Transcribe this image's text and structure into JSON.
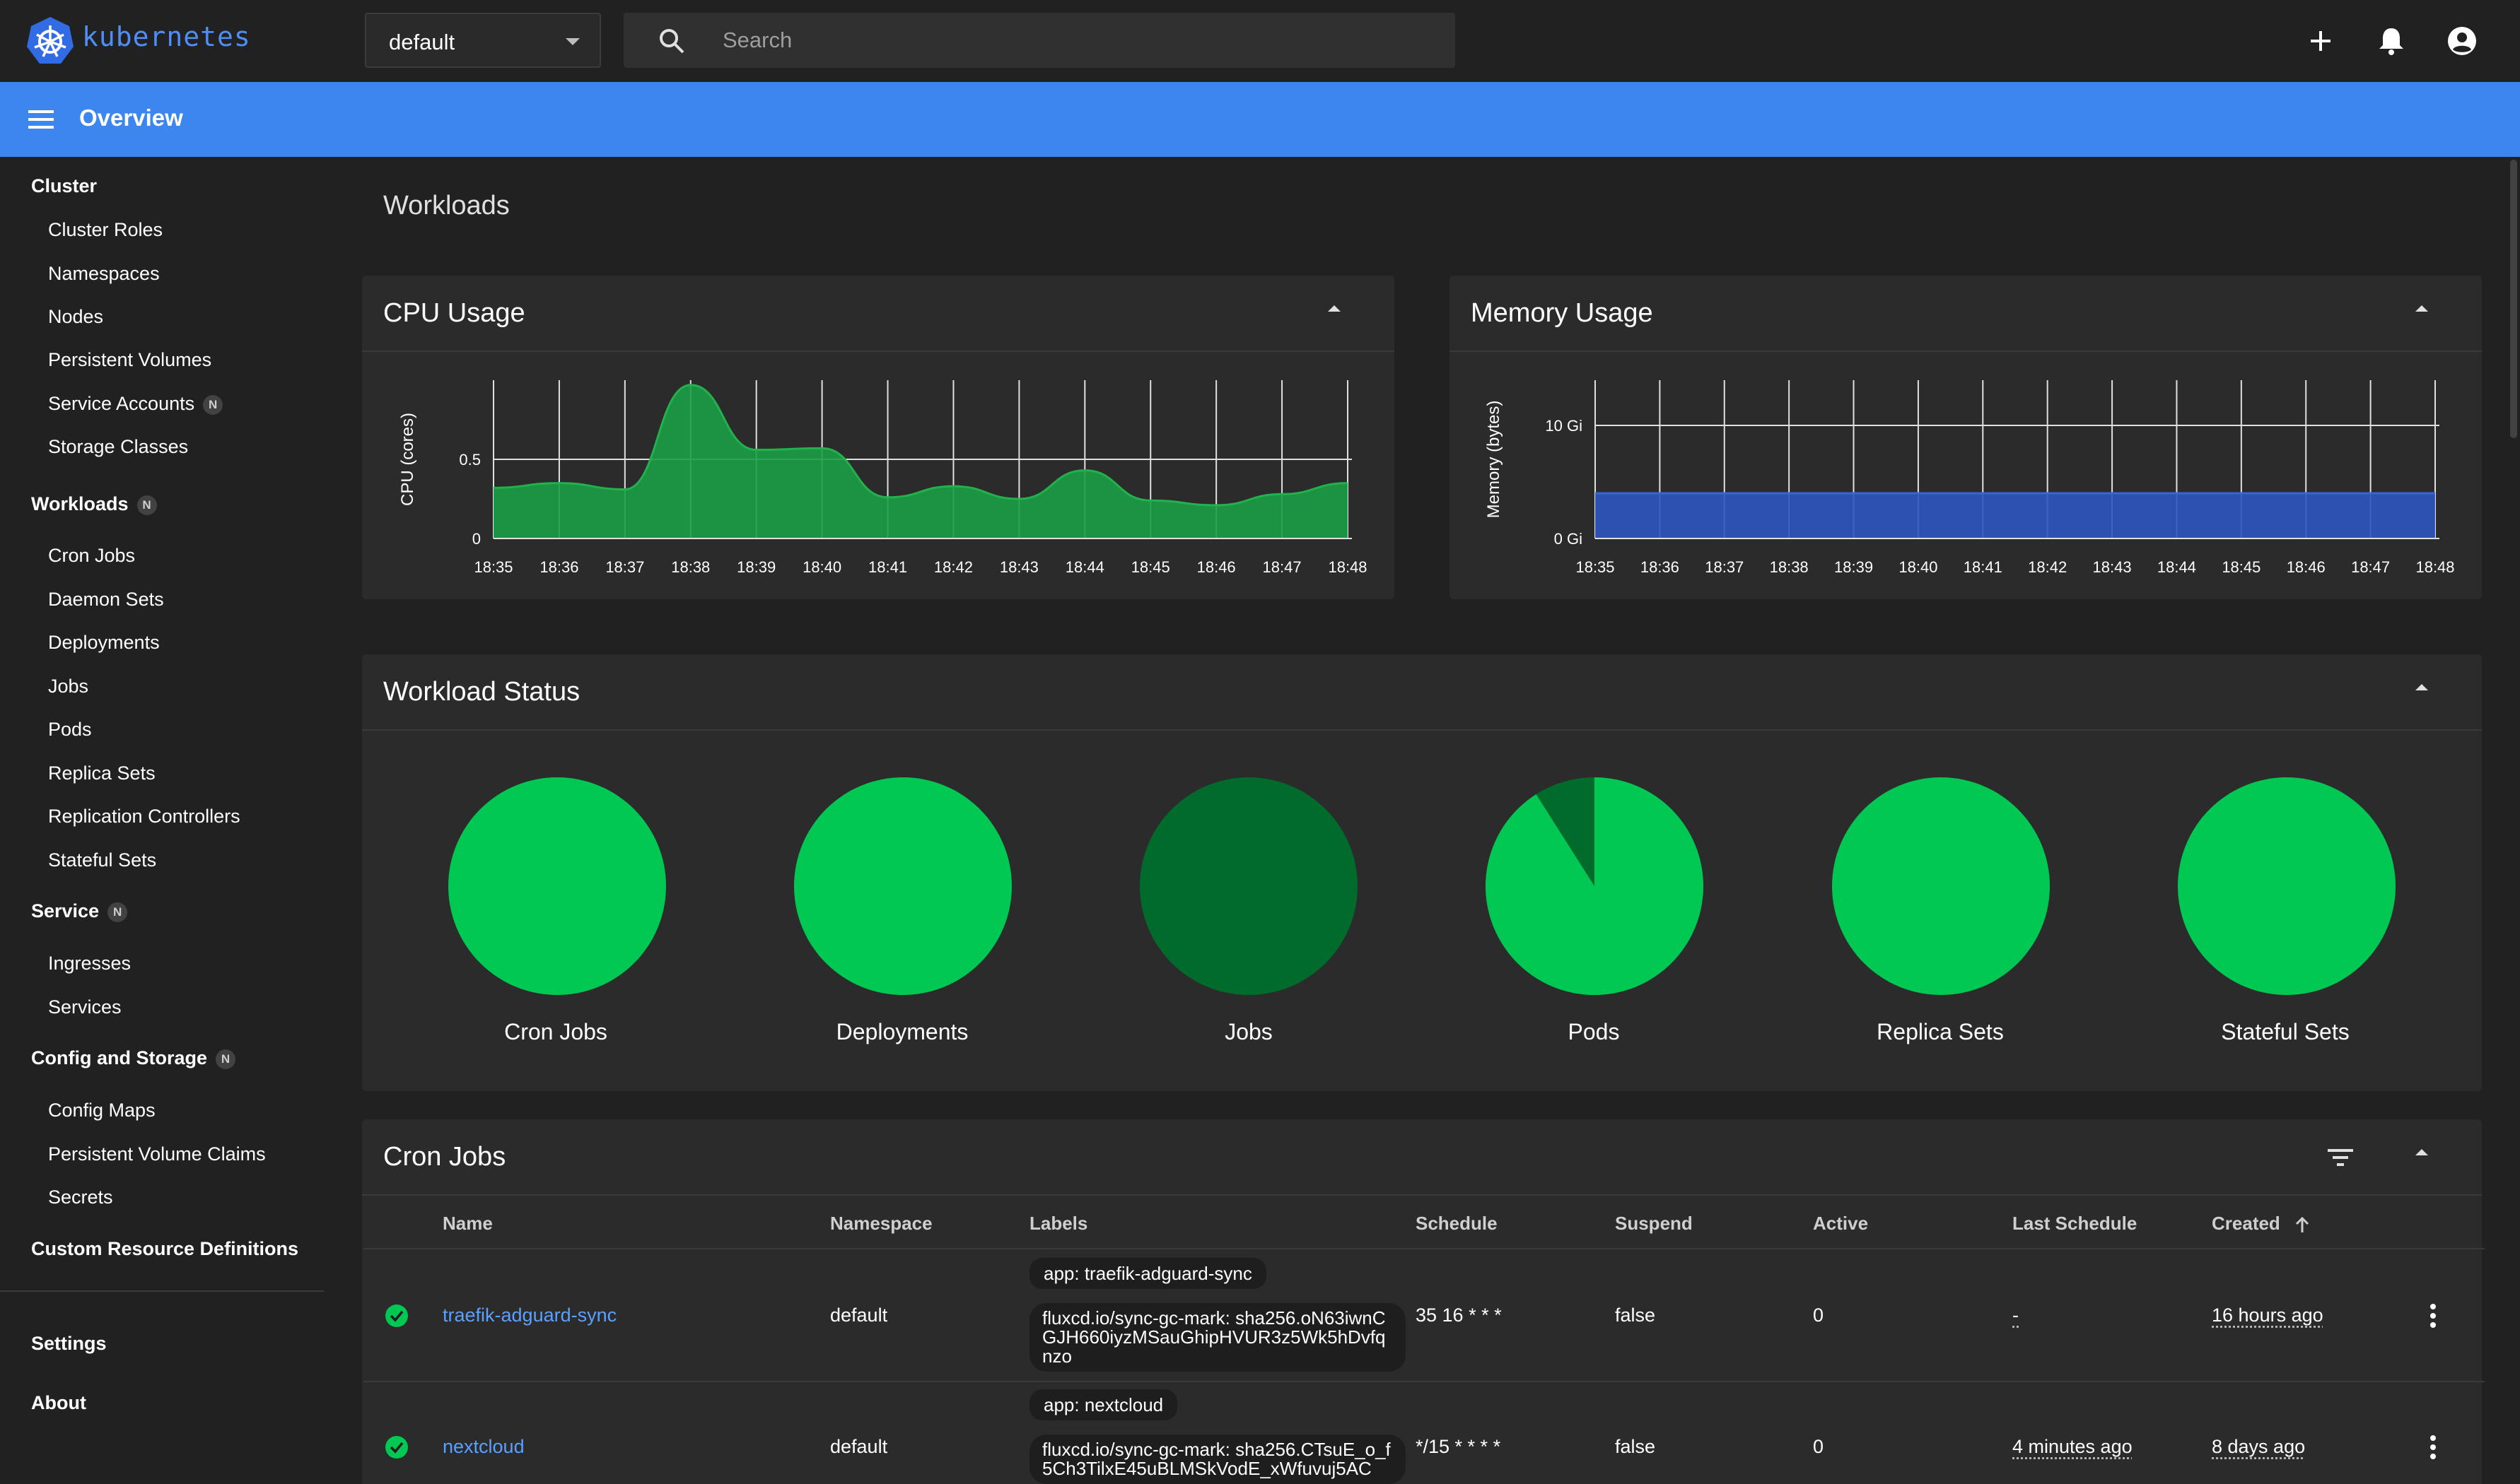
{
  "app": {
    "brand": "kubernetes"
  },
  "topbar": {
    "namespace": "default",
    "search_placeholder": "Search"
  },
  "header": {
    "title": "Overview"
  },
  "sidebar": {
    "items": [
      {
        "label": "Cluster",
        "type": "header"
      },
      {
        "label": "Cluster Roles",
        "type": "item"
      },
      {
        "label": "Namespaces",
        "type": "item"
      },
      {
        "label": "Nodes",
        "type": "item"
      },
      {
        "label": "Persistent Volumes",
        "type": "item"
      },
      {
        "label": "Service Accounts",
        "type": "item",
        "badge": "N"
      },
      {
        "label": "Storage Classes",
        "type": "item"
      },
      {
        "label": "Workloads",
        "type": "header",
        "badge": "N"
      },
      {
        "label": "Cron Jobs",
        "type": "item"
      },
      {
        "label": "Daemon Sets",
        "type": "item"
      },
      {
        "label": "Deployments",
        "type": "item"
      },
      {
        "label": "Jobs",
        "type": "item"
      },
      {
        "label": "Pods",
        "type": "item"
      },
      {
        "label": "Replica Sets",
        "type": "item"
      },
      {
        "label": "Replication Controllers",
        "type": "item"
      },
      {
        "label": "Stateful Sets",
        "type": "item"
      },
      {
        "label": "Service",
        "type": "header",
        "badge": "N"
      },
      {
        "label": "Ingresses",
        "type": "item"
      },
      {
        "label": "Services",
        "type": "item"
      },
      {
        "label": "Config and Storage",
        "type": "header",
        "badge": "N"
      },
      {
        "label": "Config Maps",
        "type": "item"
      },
      {
        "label": "Persistent Volume Claims",
        "type": "item"
      },
      {
        "label": "Secrets",
        "type": "item"
      },
      {
        "label": "Custom Resource Definitions",
        "type": "header"
      },
      {
        "label": "Settings",
        "type": "header"
      },
      {
        "label": "About",
        "type": "header"
      }
    ]
  },
  "main": {
    "section_title": "Workloads",
    "cpu_card_title": "CPU Usage",
    "memory_card_title": "Memory Usage",
    "status_card_title": "Workload Status",
    "cronjobs_card_title": "Cron Jobs"
  },
  "colors": {
    "accent": "#3d86f0",
    "success": "#00c853",
    "success_dark": "#006b2a",
    "cpu_fill": "#1a9e45",
    "memory_fill": "#2e55bf",
    "link": "#5aa0ff"
  },
  "chart_data": [
    {
      "type": "area",
      "title": "CPU Usage",
      "ylabel": "CPU (cores)",
      "x": [
        "18:35",
        "18:36",
        "18:37",
        "18:38",
        "18:39",
        "18:40",
        "18:41",
        "18:42",
        "18:43",
        "18:44",
        "18:45",
        "18:46",
        "18:47",
        "18:48"
      ],
      "series": [
        {
          "values": [
            0.32,
            0.35,
            0.31,
            0.97,
            0.56,
            0.57,
            0.26,
            0.33,
            0.25,
            0.43,
            0.24,
            0.21,
            0.28,
            0.35
          ]
        }
      ],
      "yticks": [
        "0",
        "0.5"
      ],
      "ylim": [
        0,
        1.0
      ],
      "grid": true
    },
    {
      "type": "area",
      "title": "Memory Usage",
      "ylabel": "Memory (bytes)",
      "x": [
        "18:35",
        "18:36",
        "18:37",
        "18:38",
        "18:39",
        "18:40",
        "18:41",
        "18:42",
        "18:43",
        "18:44",
        "18:45",
        "18:46",
        "18:47",
        "18:48"
      ],
      "series": [
        {
          "values": [
            4,
            4,
            4,
            4,
            4,
            4,
            4,
            4,
            4,
            4,
            4,
            4,
            4,
            4
          ]
        }
      ],
      "yticks": [
        "0 Gi",
        "10 Gi"
      ],
      "ylim": [
        0,
        14
      ],
      "grid": true
    },
    {
      "type": "pie",
      "title": "Workload Status",
      "pies": [
        {
          "label": "Cron Jobs",
          "ok_fraction": 1.0
        },
        {
          "label": "Deployments",
          "ok_fraction": 1.0
        },
        {
          "label": "Jobs",
          "ok_fraction": 0.0
        },
        {
          "label": "Pods",
          "ok_fraction": 0.91
        },
        {
          "label": "Replica Sets",
          "ok_fraction": 1.0
        },
        {
          "label": "Stateful Sets",
          "ok_fraction": 1.0
        }
      ]
    }
  ],
  "cronjobs_table": {
    "columns": [
      "Name",
      "Namespace",
      "Labels",
      "Schedule",
      "Suspend",
      "Active",
      "Last Schedule",
      "Created"
    ],
    "rows": [
      {
        "name": "traefik-adguard-sync",
        "namespace": "default",
        "labels": [
          "app: traefik-adguard-sync",
          "fluxcd.io/sync-gc-mark: sha256.oN63iwnCGJH660iyzMSauGhipHVUR3z5Wk5hDvfqnzo"
        ],
        "schedule": "35 16 * * *",
        "suspend": "false",
        "active": "0",
        "last_schedule": "-",
        "created": "16 hours ago"
      },
      {
        "name": "nextcloud",
        "namespace": "default",
        "labels": [
          "app: nextcloud",
          "fluxcd.io/sync-gc-mark: sha256.CTsuE_o_f5Ch3TilxE45uBLMSkVodE_xWfuvuj5AC"
        ],
        "schedule": "*/15 * * * *",
        "suspend": "false",
        "active": "0",
        "last_schedule": "4 minutes ago",
        "created": "8 days ago"
      }
    ]
  }
}
